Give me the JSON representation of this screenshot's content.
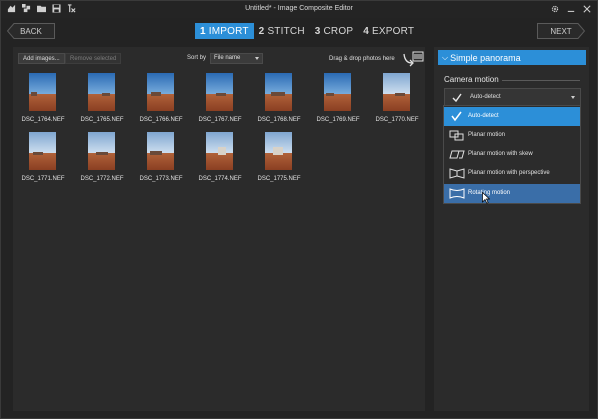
{
  "window": {
    "title": "Untitled* - Image Composite Editor"
  },
  "titlebar_icons": [
    "new-project-icon",
    "new-panorama-icon",
    "open-folder-icon",
    "save-icon",
    "export-icon"
  ],
  "window_controls": [
    "settings-icon",
    "minimize-icon",
    "close-icon"
  ],
  "nav": {
    "back_label": "BACK",
    "next_label": "NEXT"
  },
  "steps": [
    {
      "num": "1",
      "label": "IMPORT",
      "active": true
    },
    {
      "num": "2",
      "label": "STITCH",
      "active": false
    },
    {
      "num": "3",
      "label": "CROP",
      "active": false
    },
    {
      "num": "4",
      "label": "EXPORT",
      "active": false
    }
  ],
  "toolbar": {
    "add_images": "Add images...",
    "remove_selected": "Remove selected",
    "sort_by_label": "Sort by",
    "sort_value": "File name",
    "drop_hint": "Drag & drop photos here"
  },
  "images": [
    "DSC_1764.NEF",
    "DSC_1765.NEF",
    "DSC_1766.NEF",
    "DSC_1767.NEF",
    "DSC_1768.NEF",
    "DSC_1769.NEF",
    "DSC_1770.NEF",
    "DSC_1771.NEF",
    "DSC_1772.NEF",
    "DSC_1773.NEF",
    "DSC_1774.NEF",
    "DSC_1775.NEF"
  ],
  "panel": {
    "header": "Simple panorama",
    "camera_motion_label": "Camera motion",
    "selected_value": "Auto-detect",
    "options": [
      {
        "label": "Auto-detect",
        "icon": "checkmark-icon",
        "state": "selected"
      },
      {
        "label": "Planar motion",
        "icon": "planar-motion-icon",
        "state": "normal"
      },
      {
        "label": "Planar motion with skew",
        "icon": "planar-skew-icon",
        "state": "normal"
      },
      {
        "label": "Planar motion with perspective",
        "icon": "planar-perspective-icon",
        "state": "normal"
      },
      {
        "label": "Rotating motion",
        "icon": "rotating-motion-icon",
        "state": "hover"
      }
    ]
  },
  "colors": {
    "accent": "#2c8fd8",
    "background": "#232323",
    "panel": "#2b2b2b",
    "hover": "#3a6ea8"
  }
}
